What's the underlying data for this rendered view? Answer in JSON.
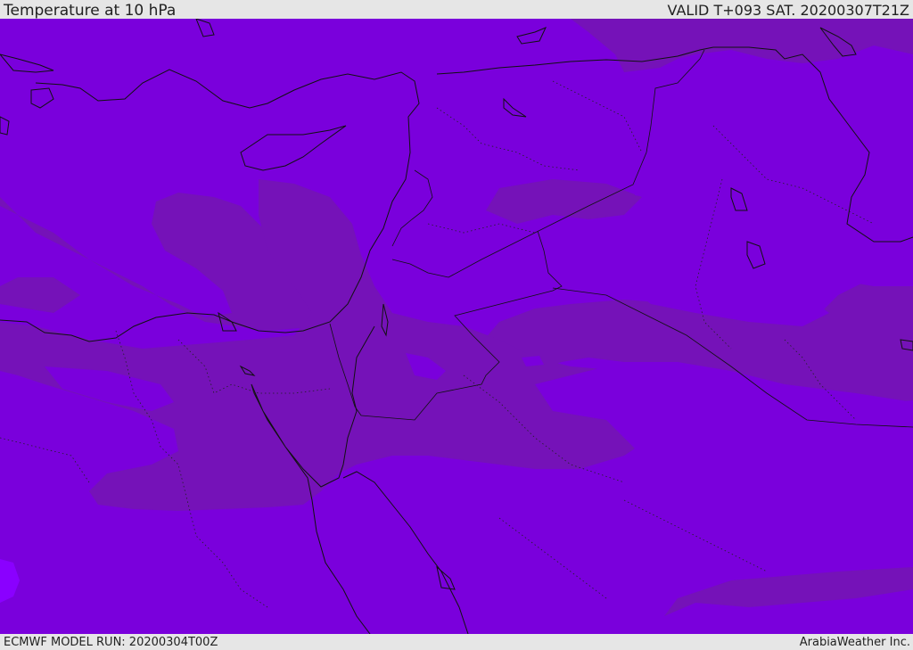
{
  "header": {
    "title": "Temperature at 10 hPa",
    "valid": "VALID T+093 SAT. 20200307T21Z"
  },
  "footer": {
    "model_run": "ECMWF MODEL RUN: 20200304T00Z",
    "credit": "ArabiaWeather Inc."
  },
  "colors": {
    "field_base": "#7a00dc",
    "field_band": "#7512b8",
    "field_light": "#8a00ff",
    "coastline": "#111111",
    "bar_background": "#e6e6e6"
  },
  "map": {
    "variable": "temperature",
    "pressure_level_hpa": 10
  }
}
